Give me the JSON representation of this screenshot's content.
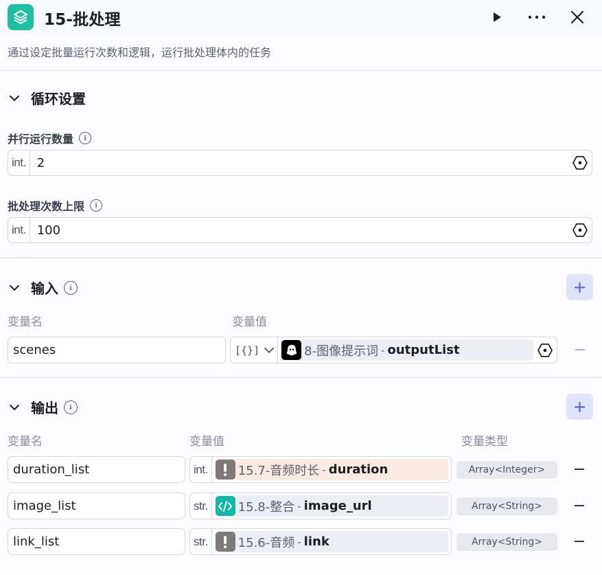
{
  "header": {
    "title": "15-批处理",
    "description": "通过设定批量运行次数和逻辑，运行批处理体内的任务",
    "icons": {
      "app": "layers-icon",
      "run": "play-icon",
      "more": "more-icon",
      "close": "close-icon"
    }
  },
  "loop_settings": {
    "title": "循环设置",
    "parallel": {
      "label": "并行运行数量",
      "type": "int.",
      "value": "2"
    },
    "max_batch": {
      "label": "批处理次数上限",
      "type": "int.",
      "value": "100"
    }
  },
  "input": {
    "title": "输入",
    "col_name": "变量名",
    "col_value": "变量值",
    "row": {
      "name": "scenes",
      "type_symbol": "[{}]",
      "node": "8-图像提示词",
      "sep": "-",
      "var": "outputList"
    }
  },
  "output": {
    "title": "输出",
    "col_name": "变量名",
    "col_value": "变量值",
    "col_type": "变量类型",
    "rows": [
      {
        "name": "duration_list",
        "type": "int.",
        "node": "15.7-音频时长",
        "sep": "-",
        "var": "duration",
        "var_type": "Array<Integer>",
        "icon": "exclamation-icon",
        "chip_color": "#fbeae2"
      },
      {
        "name": "image_list",
        "type": "str.",
        "node": "15.8-整合",
        "sep": "-",
        "var": "image_url",
        "var_type": "Array<String>",
        "icon": "code-icon",
        "chip_color": "#edeef5"
      },
      {
        "name": "link_list",
        "type": "str.",
        "node": "15.6-音频",
        "sep": "-",
        "var": "link",
        "var_type": "Array<String>",
        "icon": "exclamation-icon",
        "chip_color": "#edeef5"
      }
    ]
  },
  "colors": {
    "accent": "#4f5bdc",
    "app_icon": "#1ec0a4",
    "code_icon": "#14b8a6",
    "warn_icon": "#7e7a7a"
  }
}
